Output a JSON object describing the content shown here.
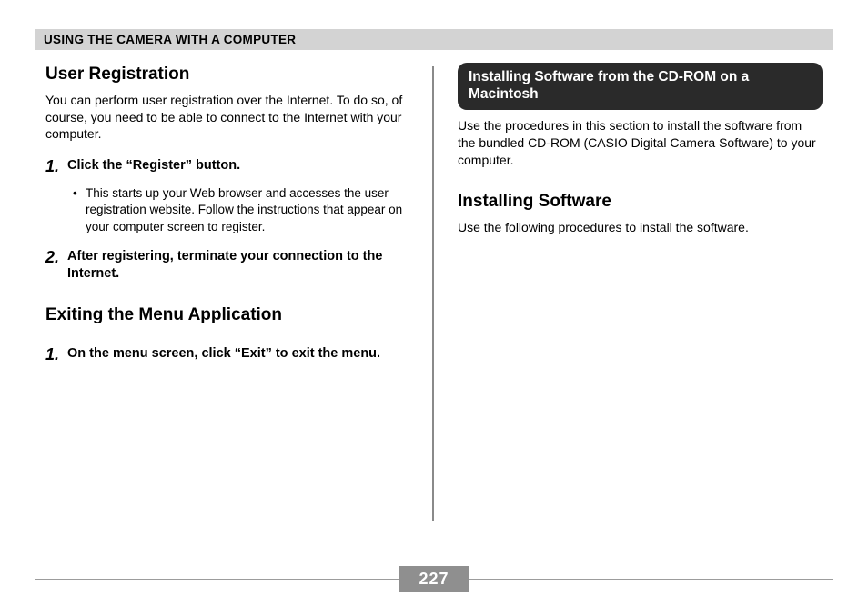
{
  "header": {
    "title": "USING THE CAMERA WITH A COMPUTER"
  },
  "left": {
    "section1_title": "User Registration",
    "section1_body": "You can perform user registration over the Internet. To do so, of course, you need to be able to connect to the Internet with your computer.",
    "step1_num": "1.",
    "step1_text": "Click the “Register” button.",
    "step1_bullet": "This starts up your Web browser and accesses the user registration website. Follow the instructions that appear on your computer screen to register.",
    "step2_num": "2.",
    "step2_text": "After registering, terminate your connection to the Internet.",
    "section2_title": "Exiting the Menu Application",
    "sec2_step1_num": "1.",
    "sec2_step1_text": "On the menu screen, click “Exit” to exit the menu."
  },
  "right": {
    "callout": "Installing Software from the CD-ROM on a Macintosh",
    "callout_body": "Use the procedures in this section to install the software from the bundled CD-ROM (CASIO Digital Camera Software) to your computer.",
    "section1_title": "Installing Software",
    "section1_body": "Use the following procedures to install the software."
  },
  "footer": {
    "page_number": "227"
  }
}
